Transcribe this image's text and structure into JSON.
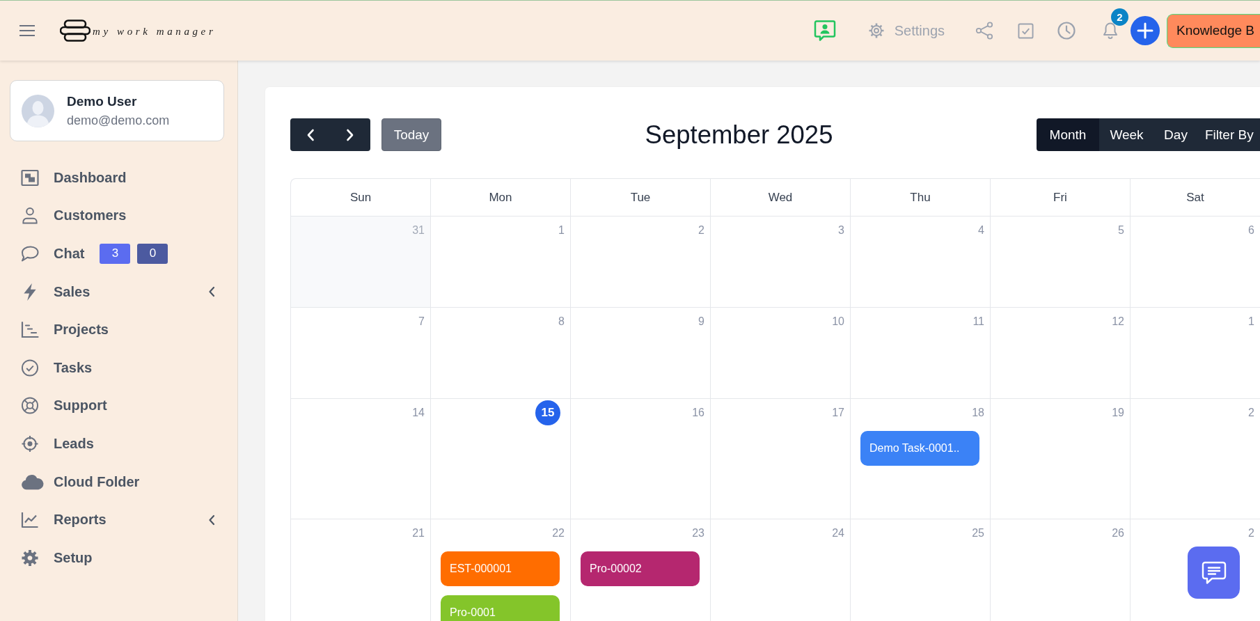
{
  "topbar": {
    "logo_text": "my work manager",
    "settings_label": "Settings",
    "notification_count": "2",
    "knowledge_button": "Knowledge B"
  },
  "user": {
    "name": "Demo User",
    "email": "demo@demo.com"
  },
  "sidebar": {
    "items": [
      {
        "label": "Dashboard",
        "submenu": false
      },
      {
        "label": "Customers",
        "submenu": false
      },
      {
        "label": "Chat",
        "submenu": false,
        "badges": [
          {
            "text": "3",
            "color": "#5b6cf0"
          },
          {
            "text": "0",
            "color": "#4c5aa0"
          }
        ]
      },
      {
        "label": "Sales",
        "submenu": true
      },
      {
        "label": "Projects",
        "submenu": false
      },
      {
        "label": "Tasks",
        "submenu": false
      },
      {
        "label": "Support",
        "submenu": false
      },
      {
        "label": "Leads",
        "submenu": false
      },
      {
        "label": "Cloud Folder",
        "submenu": false
      },
      {
        "label": "Reports",
        "submenu": true
      },
      {
        "label": "Setup",
        "submenu": false
      }
    ]
  },
  "calendar": {
    "title": "September 2025",
    "today_button": "Today",
    "views": [
      {
        "label": "Month",
        "selected": true
      },
      {
        "label": "Week",
        "selected": false
      },
      {
        "label": "Day",
        "selected": false
      },
      {
        "label": "Filter By",
        "selected": false
      }
    ],
    "weekdays": [
      "Sun",
      "Mon",
      "Tue",
      "Wed",
      "Thu",
      "Fri",
      "Sat"
    ],
    "weeks": [
      {
        "days": [
          {
            "day": "31",
            "outside": true,
            "today": false
          },
          {
            "day": "1",
            "outside": false,
            "today": false
          },
          {
            "day": "2",
            "outside": false,
            "today": false
          },
          {
            "day": "3",
            "outside": false,
            "today": false
          },
          {
            "day": "4",
            "outside": false,
            "today": false
          },
          {
            "day": "5",
            "outside": false,
            "today": false
          },
          {
            "day": "6",
            "outside": false,
            "today": false
          }
        ]
      },
      {
        "days": [
          {
            "day": "7",
            "outside": false,
            "today": false
          },
          {
            "day": "8",
            "outside": false,
            "today": false
          },
          {
            "day": "9",
            "outside": false,
            "today": false
          },
          {
            "day": "10",
            "outside": false,
            "today": false
          },
          {
            "day": "11",
            "outside": false,
            "today": false
          },
          {
            "day": "12",
            "outside": false,
            "today": false
          },
          {
            "day": "1",
            "outside": false,
            "today": false
          }
        ]
      },
      {
        "days": [
          {
            "day": "14",
            "outside": false,
            "today": false
          },
          {
            "day": "15",
            "outside": false,
            "today": true
          },
          {
            "day": "16",
            "outside": false,
            "today": false
          },
          {
            "day": "17",
            "outside": false,
            "today": false
          },
          {
            "day": "18",
            "outside": false,
            "today": false,
            "events": [
              {
                "title": "Demo Task-0001..",
                "color": "#3b82f6"
              }
            ]
          },
          {
            "day": "19",
            "outside": false,
            "today": false
          },
          {
            "day": "2",
            "outside": false,
            "today": false
          }
        ]
      },
      {
        "days": [
          {
            "day": "21",
            "outside": false,
            "today": false
          },
          {
            "day": "22",
            "outside": false,
            "today": false,
            "events": [
              {
                "title": "EST-000001",
                "color": "#ff6d00"
              },
              {
                "title": "Pro-0001",
                "color": "#84c52a"
              }
            ]
          },
          {
            "day": "23",
            "outside": false,
            "today": false,
            "events": [
              {
                "title": "Pro-00002",
                "color": "#b5276f"
              }
            ]
          },
          {
            "day": "24",
            "outside": false,
            "today": false
          },
          {
            "day": "25",
            "outside": false,
            "today": false
          },
          {
            "day": "26",
            "outside": false,
            "today": false
          },
          {
            "day": "2",
            "outside": false,
            "today": false
          }
        ]
      }
    ]
  }
}
